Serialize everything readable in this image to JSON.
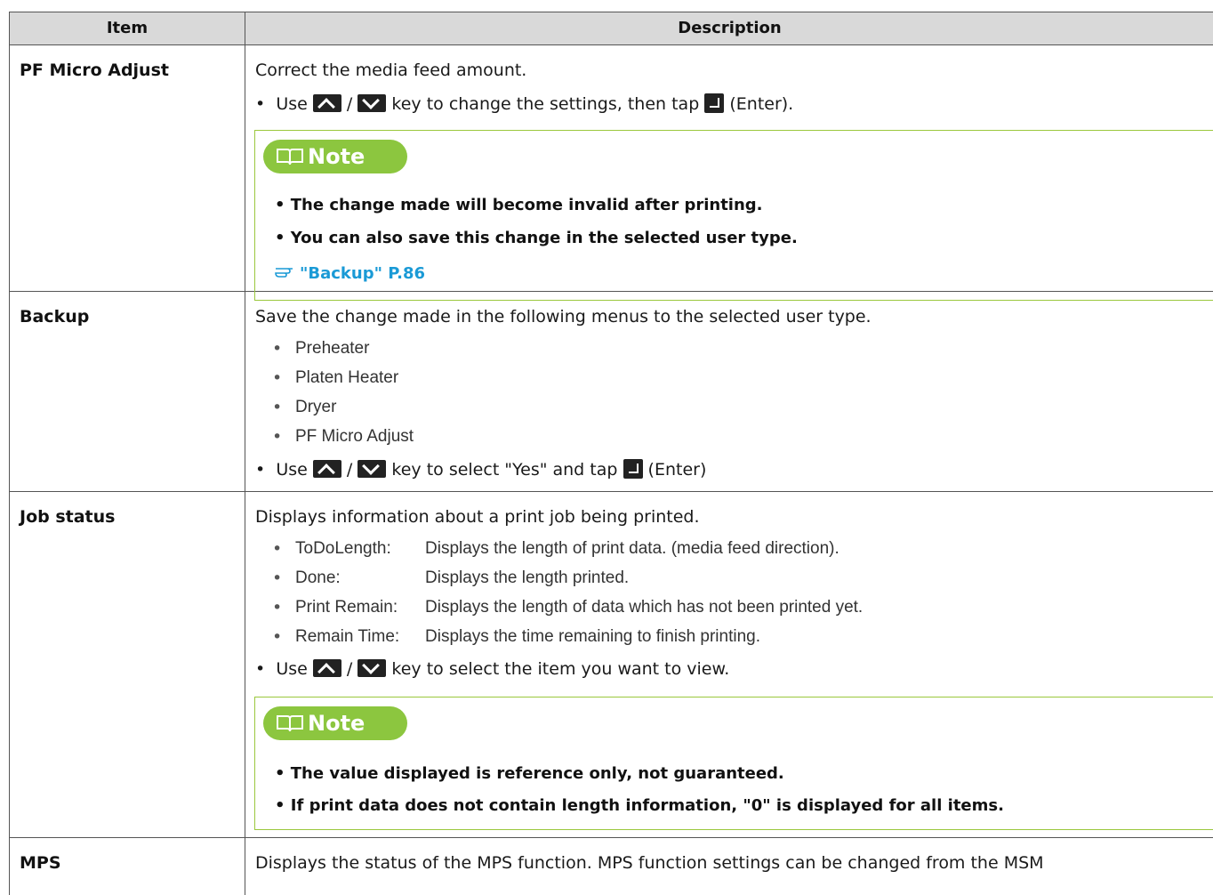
{
  "header": {
    "item": "Item",
    "description": "Description"
  },
  "rows": {
    "pf": {
      "item": "PF Micro Adjust",
      "line1": "Correct the media feed amount.",
      "bullet": "•",
      "use": "Use",
      "slash": "/",
      "key_text": "key to change the settings, then tap",
      "enter": "(Enter).",
      "note_label": "Note",
      "note1": "• The change made will become invalid after printing.",
      "note2": "• You can also save this change in the selected user type.",
      "link": "\"Backup\" P.86"
    },
    "backup": {
      "item": "Backup",
      "line1": "Save the change made in the following menus to the selected user type.",
      "list": [
        "Preheater",
        "Platen Heater",
        "Dryer",
        "PF Micro Adjust"
      ],
      "bullet": "•",
      "use": "Use",
      "slash": "/",
      "key_text": "key to select \"Yes\" and tap",
      "enter": "(Enter)"
    },
    "job": {
      "item": "Job status",
      "line1": "Displays information about a print job being printed.",
      "list": [
        {
          "label": "ToDoLength:",
          "text": "Displays the length of print data. (media feed direction)."
        },
        {
          "label": "Done:",
          "text": "Displays the length printed."
        },
        {
          "label": "Print Remain:",
          "text": "Displays the length of data which has not been printed yet."
        },
        {
          "label": "Remain Time:",
          "text": "Displays the time remaining to finish printing."
        }
      ],
      "bullet": "•",
      "use": "Use",
      "slash": "/",
      "key_text": "key to select the item you want to view.",
      "note_label": "Note",
      "note1": "• The value displayed is reference only, not guaranteed.",
      "note2": "• If print data does not contain length information, \"0\" is displayed for all items."
    },
    "mps": {
      "item": "MPS",
      "line1": "Displays the status of the MPS function. MPS function settings can be changed from the MSM"
    }
  }
}
